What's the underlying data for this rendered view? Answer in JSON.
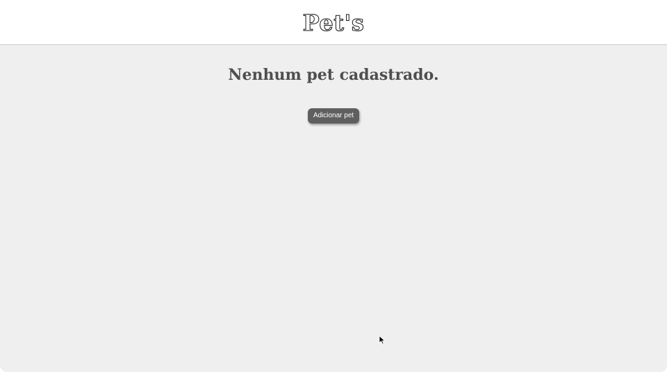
{
  "header": {
    "brand": "Pet's"
  },
  "main": {
    "empty_message": "Nenhum pet cadastrado.",
    "add_button_label": "Adicionar pet"
  },
  "colors": {
    "page_background": "#efefef",
    "header_background": "#ffffff",
    "button_background": "#5f5f5f",
    "title_text": "#4e4e4e"
  },
  "icons": {
    "pointer": "mouse-pointer-icon"
  }
}
